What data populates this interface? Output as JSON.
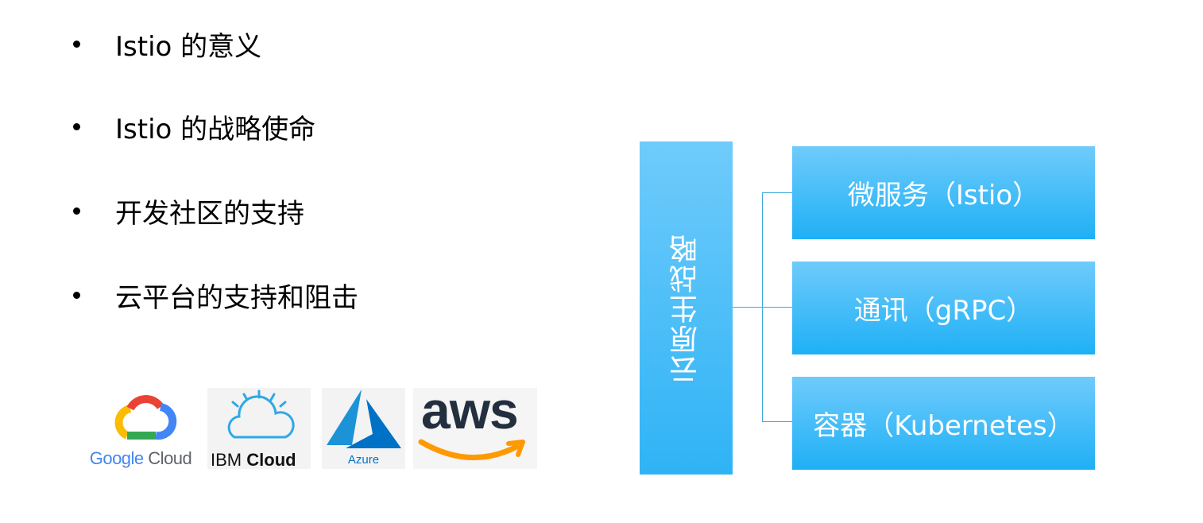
{
  "bullets": [
    "Istio 的意义",
    "Istio 的战略使命",
    "开发社区的支持",
    "云平台的支持和阻击"
  ],
  "logos": {
    "google": {
      "word1": "Google",
      "word2": "Cloud",
      "icon": "google-cloud-icon"
    },
    "ibm": {
      "word1": "IBM",
      "word2": "Cloud",
      "icon": "ibm-cloud-icon"
    },
    "azure": {
      "word": "Azure",
      "icon": "azure-icon"
    },
    "aws": {
      "word": "aws",
      "icon": "aws-smile-icon"
    }
  },
  "diagram": {
    "root": "云原生战略",
    "children": [
      "微服务（Istio）",
      "通讯（gRPC）",
      "容器（Kubernetes）"
    ]
  },
  "colors": {
    "box_light": "#6fcbfb",
    "box_dark": "#1fb0f6",
    "connector": "#3aa8df",
    "aws_orange": "#ff9900",
    "azure_blue": "#0072c6"
  }
}
